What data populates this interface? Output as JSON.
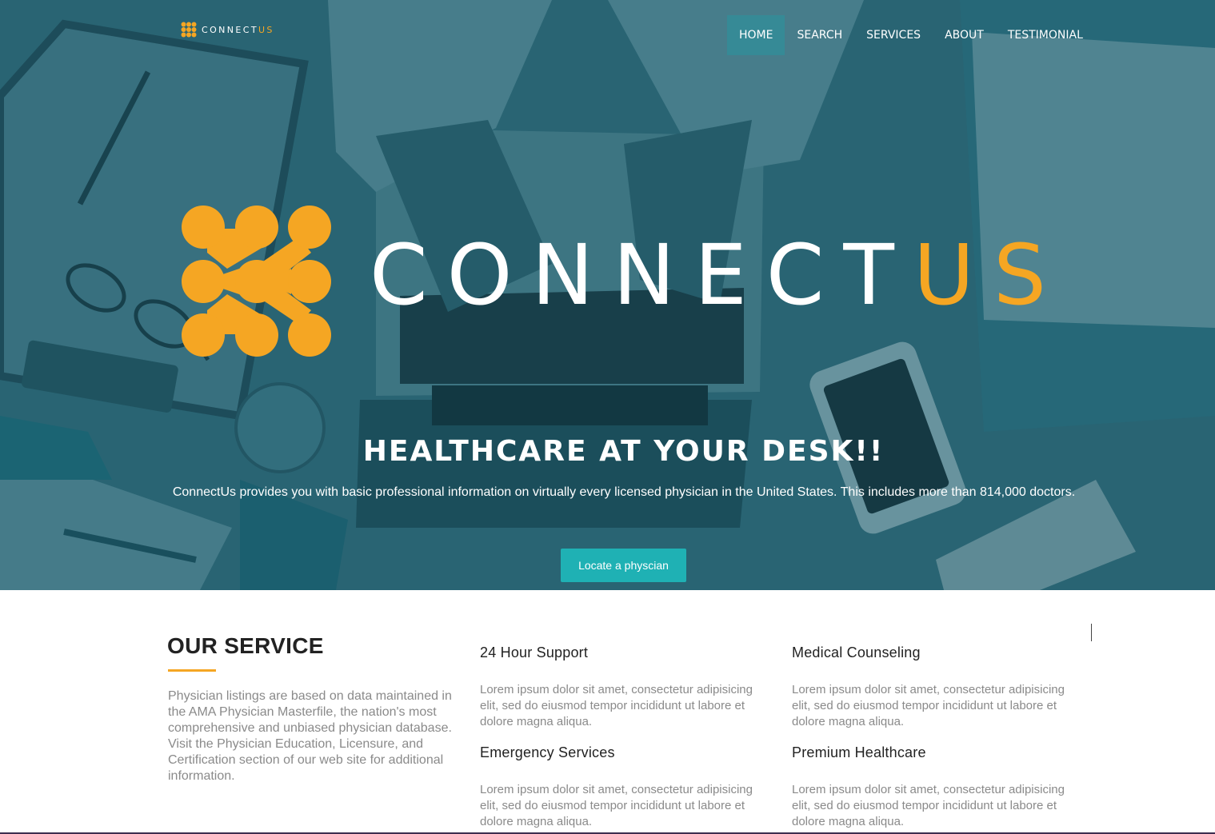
{
  "brand": {
    "name_main": "CONNECT",
    "name_accent": "US",
    "accent_color": "#f5a623"
  },
  "nav": {
    "items": [
      "HOME",
      "SEARCH",
      "SERVICES",
      "ABOUT",
      "TESTIMONIAL"
    ],
    "active": "HOME"
  },
  "hero": {
    "tagline": "HEALTHCARE AT YOUR DESK!!",
    "description": "ConnectUs provides you with basic professional information on virtually every licensed physician in the United States. This includes more than 814,000 doctors.",
    "cta_label": "Locate a physcian",
    "cta_color": "#1fb1b4",
    "background": "doctor-at-laptop-desk-photo"
  },
  "services": {
    "title": "OUR SERVICE",
    "intro": "Physician listings are based on data maintained in the AMA Physician Masterfile, the nation's most comprehensive and unbiased physician database. Visit the Physician Education, Licensure, and Certification section of our web site for additional information.",
    "features": [
      {
        "title": "24 Hour Support",
        "text": "Lorem ipsum dolor sit amet, consectetur adipisicing elit, sed do eiusmod tempor incididunt ut labore et dolore magna aliqua."
      },
      {
        "title": "Medical Counseling",
        "text": "Lorem ipsum dolor sit amet, consectetur adipisicing elit, sed do eiusmod tempor incididunt ut labore et dolore magna aliqua."
      },
      {
        "title": "Emergency Services",
        "text": "Lorem ipsum dolor sit amet, consectetur adipisicing elit, sed do eiusmod tempor incididunt ut labore et dolore magna aliqua."
      },
      {
        "title": "Premium Healthcare",
        "text": "Lorem ipsum dolor sit amet, consectetur adipisicing elit, sed do eiusmod tempor incididunt ut labore et dolore magna aliqua."
      }
    ]
  }
}
